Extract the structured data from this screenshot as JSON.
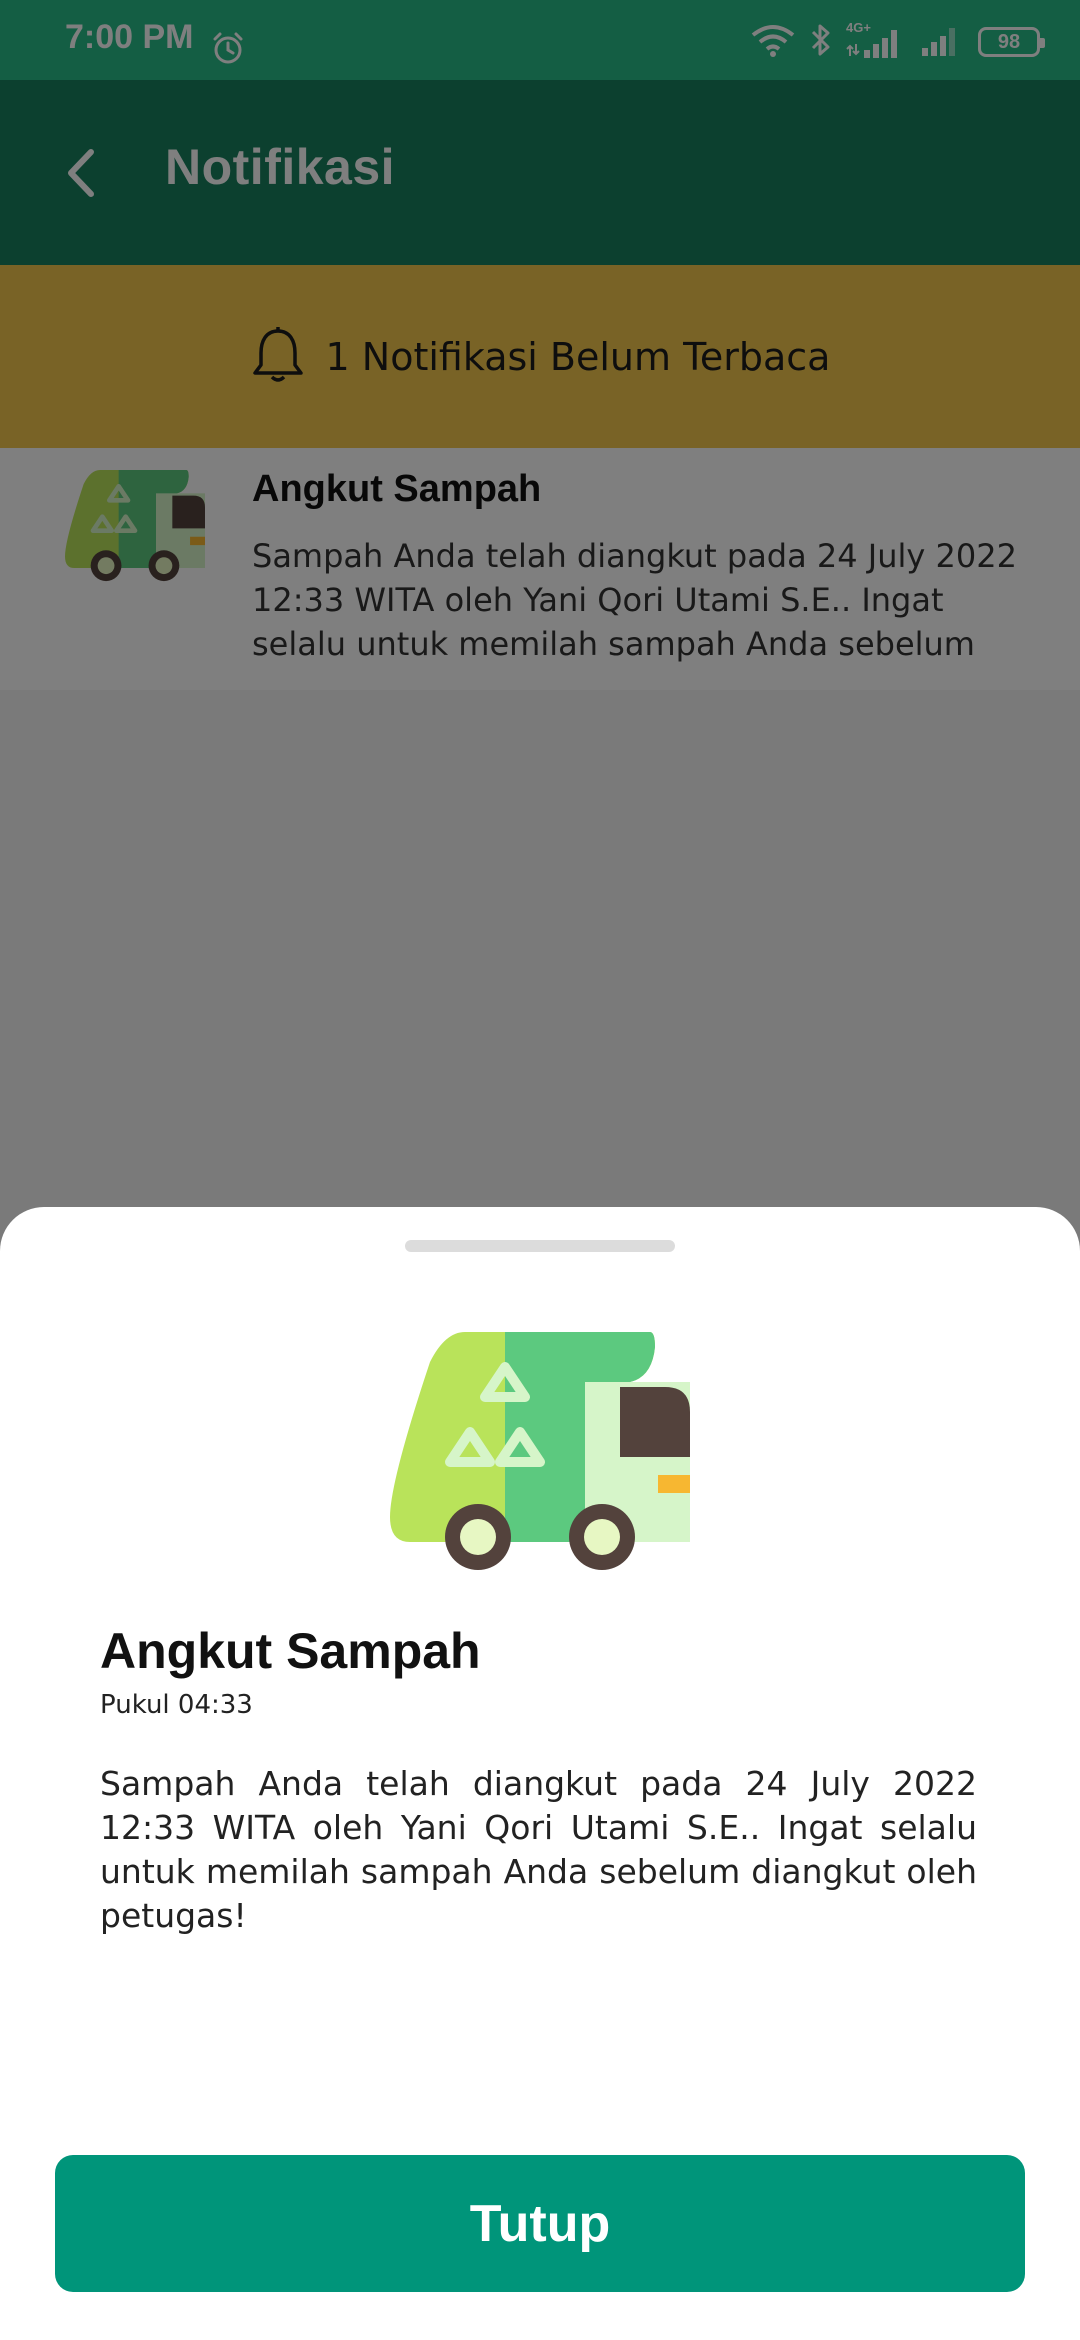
{
  "status_bar": {
    "time": "7:00 PM",
    "network": "4G+",
    "battery": "98",
    "icons": [
      "alarm-icon",
      "wifi-icon",
      "bluetooth-icon",
      "signal-icon",
      "signal-icon",
      "battery-icon"
    ]
  },
  "app_bar": {
    "title": "Notifikasi",
    "back_icon": "chevron-left-icon"
  },
  "unread_banner": {
    "text": "1 Notifikasi Belum Terbaca",
    "icon": "bell-icon"
  },
  "notifications": [
    {
      "title": "Angkut Sampah",
      "body": "Sampah Anda telah diangkut pada 24 July 2022 12:33 WITA oleh Yani Qori Utami S.E.. Ingat selalu untuk memilah sampah Anda sebelum diangkut ...",
      "icon": "garbage-truck-icon"
    }
  ],
  "sheet": {
    "title": "Angkut Sampah",
    "time": "Pukul 04:33",
    "body": "Sampah Anda telah diangkut pada 24 July 2022 12:33 WITA oleh Yani Qori Utami S.E.. Ingat selalu untuk memilah sampah Anda sebelum diangkut oleh petugas!",
    "close_label": "Tutup",
    "illustration": "garbage-truck-icon"
  },
  "colors": {
    "status_bar": "#29bc88",
    "app_bar": "#19805f",
    "banner": "#f2c74c",
    "button": "#00957a"
  }
}
